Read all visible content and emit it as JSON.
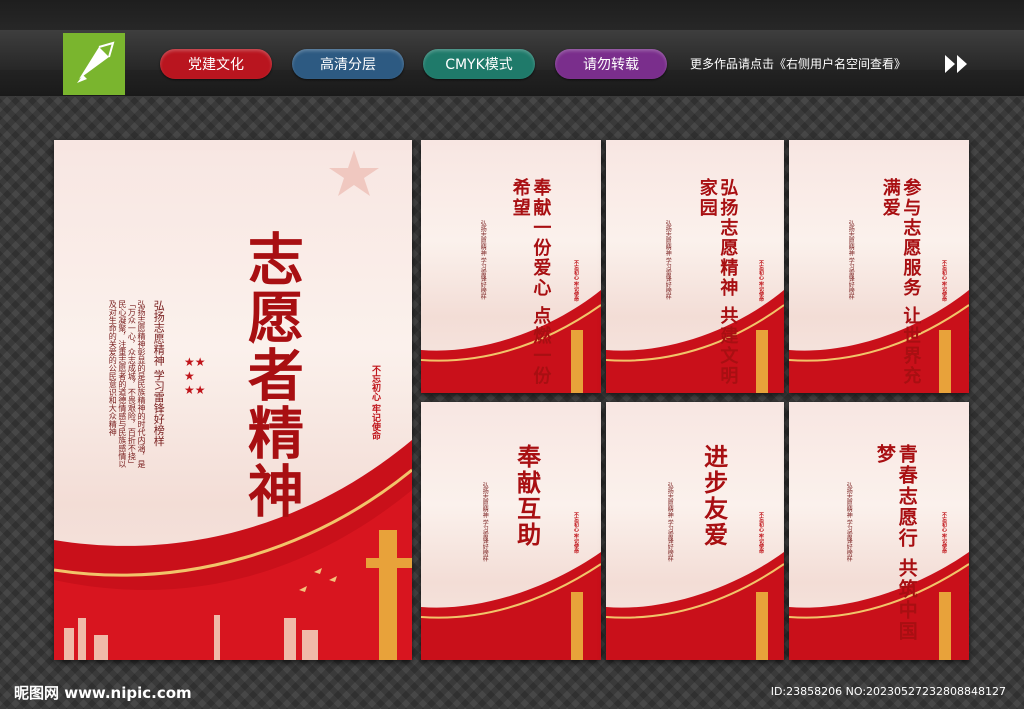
{
  "header": {
    "pills": [
      {
        "label": "党建文化",
        "color": "#b9151f"
      },
      {
        "label": "高清分层",
        "color": "#2d5a82"
      },
      {
        "label": "CMYK模式",
        "color": "#1f7a6a"
      },
      {
        "label": "请勿转载",
        "color": "#7a2e8c"
      }
    ],
    "note": "更多作品请点击《右侧用户名空间查看》"
  },
  "main_poster": {
    "title": "志愿者精神",
    "subtitle": "弘扬志愿精神 学习雷锋好榜样",
    "body": "弘扬志愿精神彰显的是民族精神的时代内涵，是「万众一心，众志成城，不畏艰险，百折不挠」民心凝聚，注重志愿者的道德情感与民族感情以及对生命的关爱的公民意识和大众精神",
    "seal": "不忘初心 牢记使命"
  },
  "posters": [
    {
      "title": "奉献一份爱心 点燃一份希望"
    },
    {
      "title": "弘扬志愿精神 共建文明家园"
    },
    {
      "title": "参与志愿服务 让世界充满爱"
    },
    {
      "title": "奉献互助"
    },
    {
      "title": "进步友爱"
    },
    {
      "title": "青春志愿行 共筑中国梦"
    }
  ],
  "poster_subtitle": "弘扬志愿精神 学习雷锋好榜样",
  "poster_seal": "不忘初心 牢记使命",
  "footer": {
    "site": "昵图网 www.nipic.com",
    "id": "ID:23858206 NO:20230527232808848127"
  }
}
